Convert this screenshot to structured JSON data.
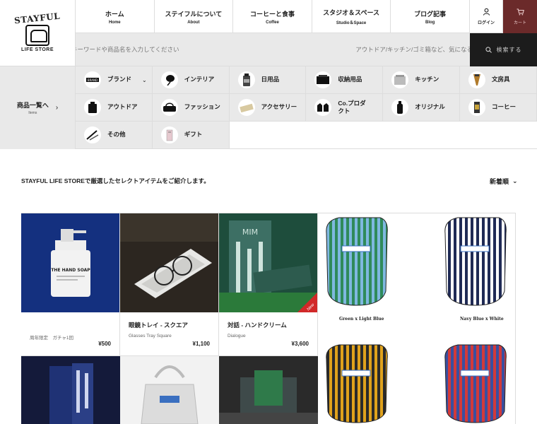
{
  "logo": {
    "top_text": "STAYFUL",
    "bottom_text": "LIFE STORE"
  },
  "nav": [
    {
      "jp": "ホーム",
      "en": "Home"
    },
    {
      "jp": "ステイフルについて",
      "en": "About"
    },
    {
      "jp": "コーヒーと食事",
      "en": "Coffee"
    },
    {
      "jp": "スタジオ＆スペース",
      "en": "Studio＆Space"
    },
    {
      "jp": "ブログ記事",
      "en": "Blog"
    }
  ],
  "login": {
    "label": "ログイン",
    "icon": "user-icon"
  },
  "cart": {
    "label": "カート",
    "icon": "cart-icon"
  },
  "search": {
    "placeholder": "キーワードや商品名を入力してください",
    "hint": "アウトドア/キッチン/ゴミ箱など、気になる",
    "button_label": "検索する",
    "icon": "search-icon"
  },
  "categories": {
    "side_title": "商品一覧へ",
    "side_sub": "Items",
    "items": [
      {
        "label": "ブランド",
        "icon": "brand-icon",
        "has_chevron": true
      },
      {
        "label": "インテリア",
        "icon": "lamp-icon"
      },
      {
        "label": "日用品",
        "icon": "bottle-icon"
      },
      {
        "label": "収納用品",
        "icon": "box-icon"
      },
      {
        "label": "キッチン",
        "icon": "kitchen-icon"
      },
      {
        "label": "文房具",
        "icon": "pen-icon"
      },
      {
        "label": "アウトドア",
        "icon": "outdoor-icon"
      },
      {
        "label": "ファッション",
        "icon": "bag-icon"
      },
      {
        "label": "アクセサリー",
        "icon": "accessory-icon"
      },
      {
        "label": "Co.プロダクト",
        "icon": "glove-icon"
      },
      {
        "label": "オリジナル",
        "icon": "flask-icon"
      },
      {
        "label": "コーヒー",
        "icon": "coffee-icon"
      },
      {
        "label": "その他",
        "icon": "tools-icon"
      },
      {
        "label": "ギフト",
        "icon": "gift-icon"
      }
    ]
  },
  "listing": {
    "intro": "STAYFUL LIFE STOREで厳選したセレクトアイテムをご紹介します。",
    "sort_label": "新着順"
  },
  "products": [
    {
      "title": "",
      "sub": "周年限定　ガチャ1回",
      "price": "¥500",
      "image": "soap-bottle"
    },
    {
      "title": "眼鏡トレイ - スクエア",
      "sub": "Glasses Tray Square",
      "price": "¥1,100",
      "image": "glasses-tray"
    },
    {
      "title": "対話 - ハンドクリーム",
      "sub": "Dialogue",
      "price": "¥3,600",
      "image": "hand-cream",
      "badge": "New"
    }
  ],
  "pouches": [
    {
      "caption": "Green x Light Blue",
      "colors": [
        "#2f8a5a",
        "#7fb8e0"
      ]
    },
    {
      "caption": "Navy Blue x White",
      "colors": [
        "#1f2a55",
        "#ffffff"
      ]
    },
    {
      "caption": "",
      "colors": [
        "#e0a21c",
        "#2a2a2a"
      ]
    },
    {
      "caption": "",
      "colors": [
        "#d23a3a",
        "#3a4fa0"
      ]
    }
  ],
  "soap_label": "THE HAND SOAP",
  "cream_brand": "MIM"
}
